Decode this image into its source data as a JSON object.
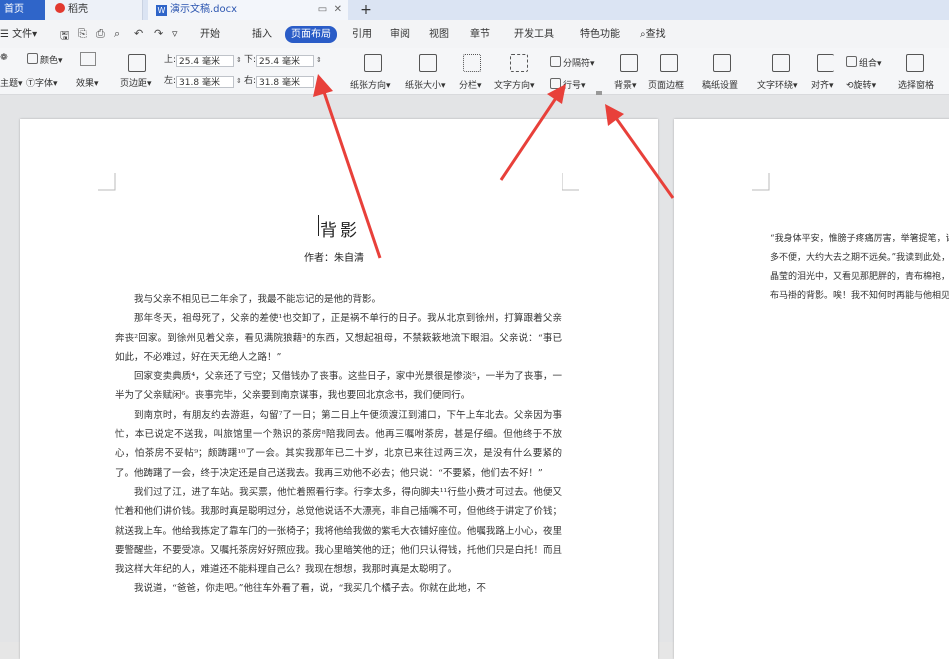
{
  "tabs": {
    "home": "首页",
    "daoke": "稻壳",
    "doc": "演示文稿.docx",
    "add": "+"
  },
  "menu": {
    "file": "文件",
    "items": [
      "开始",
      "插入",
      "页面布局",
      "引用",
      "审阅",
      "视图",
      "章节",
      "开发工具",
      "特色功能"
    ],
    "active": "页面布局",
    "search": "查找"
  },
  "ribbon": {
    "theme": "主题",
    "colors": "颜色",
    "fonts": "字体",
    "effects": "效果",
    "margins": "页边距",
    "top_label": "上:",
    "top_value": "25.4 毫米",
    "bottom_label": "下:",
    "bottom_value": "25.4 毫米",
    "left_label": "左:",
    "left_value": "31.8 毫米",
    "right_label": "右:",
    "right_value": "31.8 毫米",
    "orientation": "纸张方向",
    "size": "纸张大小",
    "columns": "分栏",
    "text_direction": "文字方向",
    "separator": "分隔符",
    "line_number": "行号",
    "background": "背景",
    "page_border": "页面边框",
    "paper_setup": "稿纸设置",
    "wrap": "文字环绕",
    "align": "对齐",
    "group": "组合",
    "rotate": "旋转",
    "selection_pane": "选择窗格"
  },
  "document": {
    "title": "背影",
    "author": "作者：朱自清",
    "paragraphs": [
      "我与父亲不相见已二年余了，我最不能忘记的是他的背影。",
      "那年冬天，祖母死了，父亲的差使¹也交卸了，正是祸不单行的日子。我从北京到徐州，打算跟着父亲奔丧²回家。到徐州见着父亲，看见满院狼藉³的东西，又想起祖母，不禁簌簌地流下眼泪。父亲说：“事已如此，不必难过，好在天无绝人之路！”",
      "回家变卖典质⁴，父亲还了亏空；又借钱办了丧事。这些日子，家中光景很是惨淡⁵，一半为了丧事，一半为了父亲赋闲⁶。丧事完毕，父亲要到南京谋事，我也要回北京念书，我们便同行。",
      "到南京时，有朋友约去游逛，勾留⁷了一日；第二日上午便须渡江到浦口，下午上车北去。父亲因为事忙，本已说定不送我，叫旅馆里一个熟识的茶房⁸陪我同去。他再三嘱咐茶房，甚是仔细。但他终于不放心，怕茶房不妥帖⁹；颇踌躇¹⁰了一会。其实我那年已二十岁，北京已来往过两三次，是没有什么要紧的了。他踌躇了一会，终于决定还是自己送我去。我再三劝他不必去；他只说：“不要紧，他们去不好！”",
      "我们过了江，进了车站。我买票，他忙着照看行李。行李太多，得向脚夫¹¹行些小费才可过去。他便又忙着和他们讲价钱。我那时真是聪明过分，总觉他说话不大漂亮，非自己插嘴不可，但他终于讲定了价钱；就送我上车。他给我拣定了靠车门的一张椅子；我将他给我做的紫毛大衣铺好座位。他嘱我路上小心，夜里要警醒些，不要受凉。又嘱托茶房好好照应我。我心里暗笑他的迂；他们只认得钱，托他们只是白托！而且我这样大年纪的人，难道还不能料理自己么？我现在想想，我那时真是太聪明了。",
      "我说道，“爸爸，你走吧。”他往车外看了看，说，“我买几个橘子去。你就在此地，不"
    ],
    "page2_text": "“我身体平安，惟膀子疼痛厉害，举箸提笔，诸多不便，大约大去之期不远矣。”我读到此处，在晶莹的泪光中，又看见那肥胖的，青布棉袍，黑布马褂的背影。唉！我不知何时再能与他相见！"
  }
}
